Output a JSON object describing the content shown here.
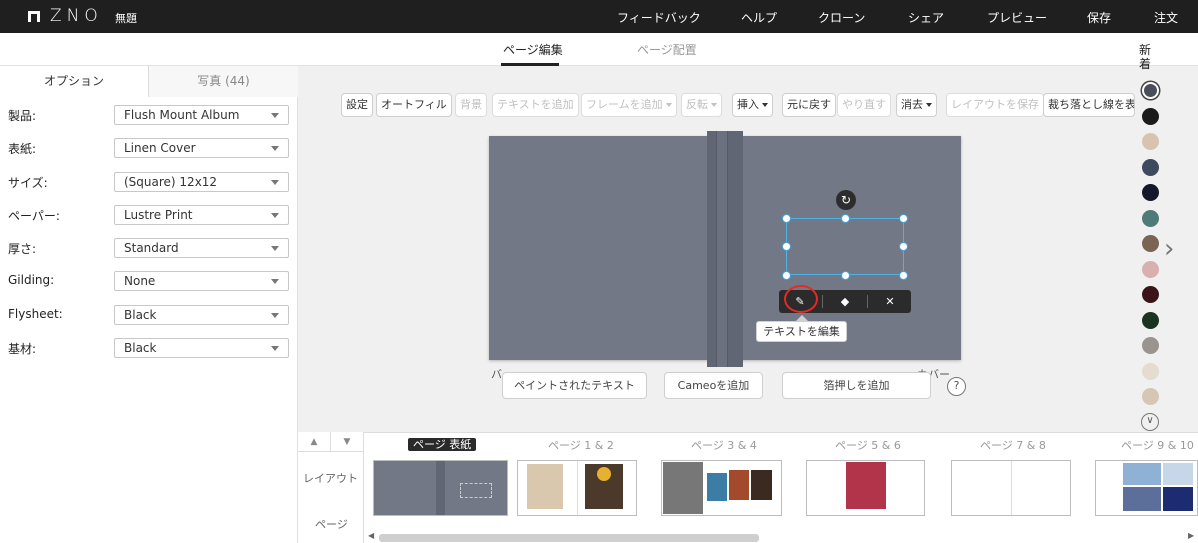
{
  "app": {
    "logo": "ZNO",
    "title": "無題"
  },
  "topnav": [
    "フィードバック",
    "ヘルプ",
    "クローン",
    "シェア",
    "プレビュー",
    "保存",
    "注文"
  ],
  "subtabs": [
    "ページ編集",
    "ページ配置"
  ],
  "leftpanel": {
    "tabs": [
      "オプション",
      "写真 (44)"
    ],
    "options": [
      {
        "label": "製品:",
        "value": "Flush Mount Album"
      },
      {
        "label": "表紙:",
        "value": "Linen Cover"
      },
      {
        "label": "サイズ:",
        "value": "(Square) 12x12"
      },
      {
        "label": "ペーパー:",
        "value": "Lustre Print"
      },
      {
        "label": "厚さ:",
        "value": "Standard"
      },
      {
        "label": "Gilding:",
        "value": "None"
      },
      {
        "label": "Flysheet:",
        "value": "Black"
      },
      {
        "label": "基材:",
        "value": "Black"
      }
    ]
  },
  "toolbar": [
    {
      "label": "設定",
      "enabled": true
    },
    {
      "label": "オートフィル",
      "enabled": true
    },
    {
      "label": "背景",
      "enabled": false
    },
    {
      "label": "テキストを追加",
      "enabled": false
    },
    {
      "label": "フレームを追加",
      "enabled": false
    },
    {
      "label": "反転",
      "enabled": false
    },
    {
      "label": "挿入",
      "enabled": true
    },
    {
      "label": "元に戻す",
      "enabled": true
    },
    {
      "label": "やり直す",
      "enabled": false
    },
    {
      "label": "消去",
      "enabled": true
    },
    {
      "label": "レイアウトを保存",
      "enabled": false
    },
    {
      "label": "裁ち落とし線を表示",
      "enabled": true
    }
  ],
  "canvas": {
    "cover_labels": [
      "バ…",
      "…カバー"
    ],
    "tooltip": "テキストを編集",
    "cover_color": "#737886"
  },
  "cover_buttons": [
    "ペイントされたテキスト",
    "Cameoを追加",
    "箔押しを追加"
  ],
  "swatches": {
    "label": "新着",
    "colors": [
      "#4a4e5a",
      "#1b1b1b",
      "#d7c4b0",
      "#3e4a5e",
      "#15172a",
      "#4e7b78",
      "#7a6452",
      "#d8b0b0",
      "#3a1418",
      "#1c3322",
      "#9a948e",
      "#e3dccf",
      "#d6c6b4"
    ]
  },
  "bottom": {
    "layout_label": "レイアウト",
    "page_label": "ページ",
    "pages": [
      "ページ 表紙",
      "ページ 1 & 2",
      "ページ 3 & 4",
      "ページ 5 & 6",
      "ページ 7 & 8",
      "ページ 9 & 10"
    ]
  }
}
